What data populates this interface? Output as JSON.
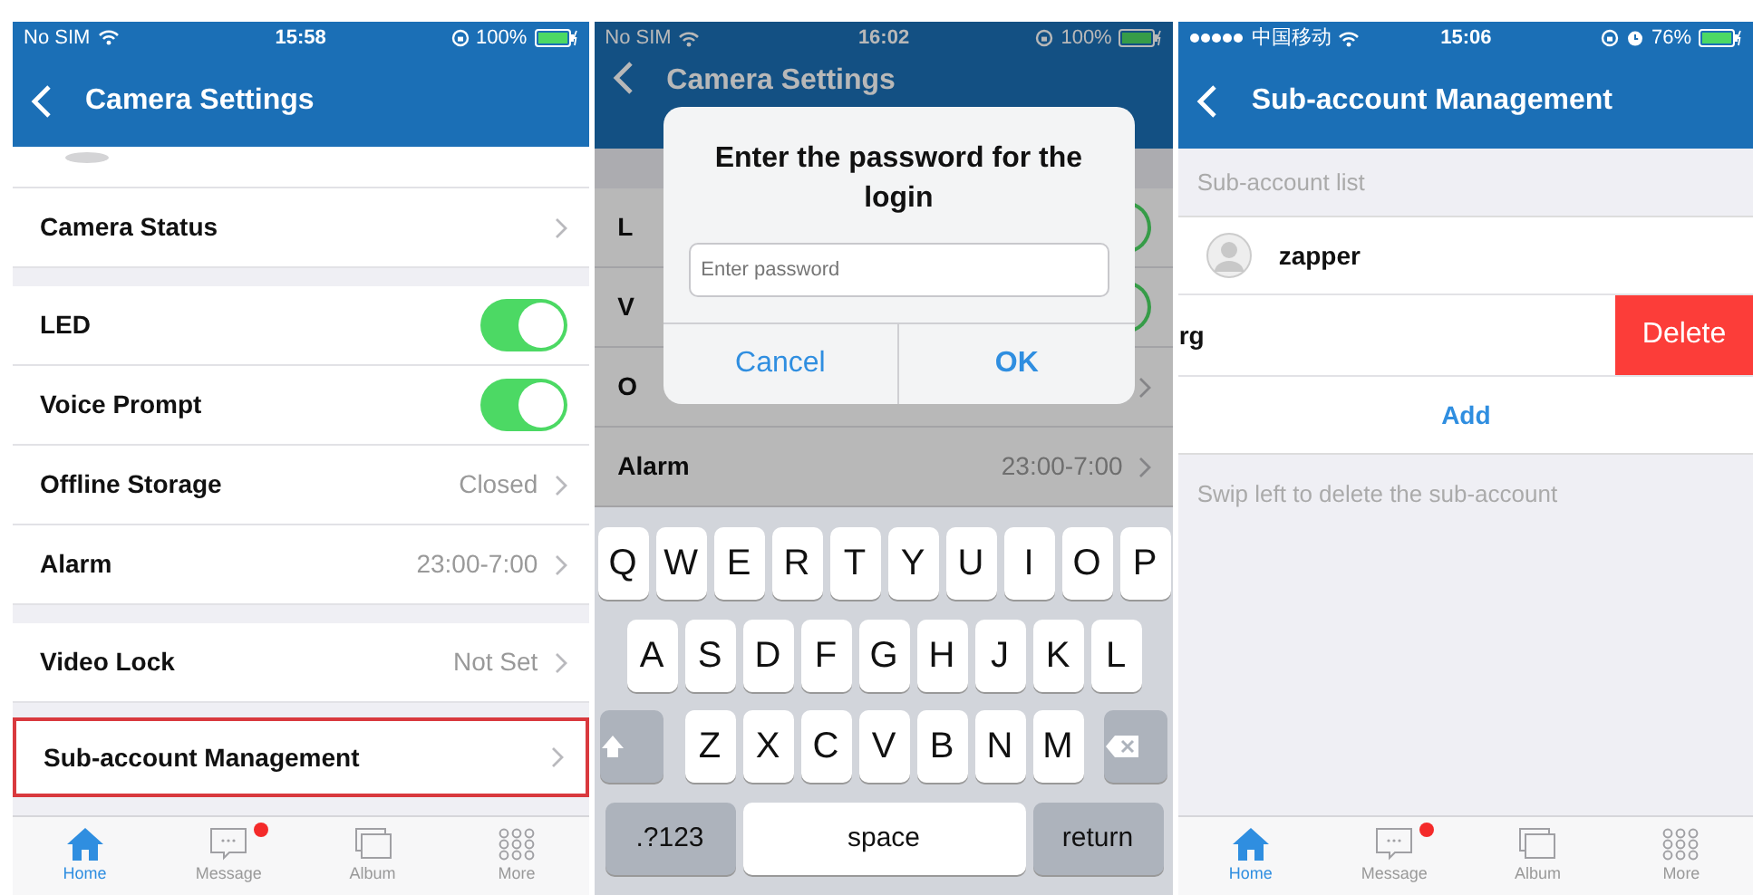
{
  "screen_settings": {
    "status_bar": {
      "carrier": "No SIM",
      "time": "15:58",
      "battery": "100%"
    },
    "nav": {
      "title": "Camera Settings"
    },
    "groups": [
      [
        {
          "kind": "link",
          "label": "Camera Status",
          "highlighted": false
        }
      ],
      [
        {
          "kind": "toggle",
          "label": "LED",
          "on": true,
          "highlighted": false
        },
        {
          "kind": "toggle",
          "label": "Voice Prompt",
          "on": true,
          "highlighted": false
        },
        {
          "kind": "link",
          "label": "Offline Storage",
          "value": "Closed",
          "highlighted": false
        },
        {
          "kind": "link",
          "label": "Alarm",
          "value": "23:00-7:00",
          "highlighted": false
        }
      ],
      [
        {
          "kind": "link",
          "label": "Video Lock",
          "value": "Not Set",
          "highlighted": false
        }
      ],
      [
        {
          "kind": "link",
          "label": "Sub-account Management",
          "highlighted": true
        }
      ]
    ],
    "tab_bar": [
      {
        "label": "Home",
        "selected": true,
        "badge": false
      },
      {
        "label": "Message",
        "selected": false,
        "badge": true
      },
      {
        "label": "Album",
        "selected": false,
        "badge": false
      },
      {
        "label": "More",
        "selected": false,
        "badge": false
      }
    ]
  },
  "screen_password": {
    "status_bar": {
      "carrier": "No SIM",
      "time": "16:02",
      "battery": "100%"
    },
    "nav": {
      "title": "Camera Settings"
    },
    "rows": [
      {
        "kind": "toggle",
        "label": "L",
        "on": true
      },
      {
        "kind": "toggle",
        "label": "V",
        "on": true
      },
      {
        "kind": "link",
        "label": "O"
      },
      {
        "kind": "link",
        "label": "Alarm",
        "value": "23:00-7:00"
      }
    ],
    "dialog": {
      "title": "Enter the password for the login",
      "placeholder": "Enter password",
      "buttons": [
        "Cancel",
        "OK"
      ]
    },
    "keyboard": {
      "rows": [
        [
          "Q",
          "W",
          "E",
          "R",
          "T",
          "Y",
          "U",
          "I",
          "O",
          "P"
        ],
        [
          "A",
          "S",
          "D",
          "F",
          "G",
          "H",
          "J",
          "K",
          "L"
        ],
        [
          "Z",
          "X",
          "C",
          "V",
          "B",
          "N",
          "M"
        ]
      ],
      "bottom": [
        ".?123",
        "space",
        "return"
      ]
    }
  },
  "screen_sub_accounts": {
    "status_bar": {
      "carrier": "中国移动",
      "time": "15:06",
      "battery": "76%"
    },
    "nav": {
      "title": "Sub-account Management"
    },
    "section_header": "Sub-account list",
    "accounts": [
      {
        "name": "zapper",
        "swiped": false
      },
      {
        "name": "rg",
        "swiped": true
      }
    ],
    "delete_label": "Delete",
    "add_label": "Add",
    "footer": "Swip left to delete the sub-account",
    "tab_bar": [
      {
        "label": "Home",
        "selected": true,
        "badge": false
      },
      {
        "label": "Message",
        "selected": false,
        "badge": true
      },
      {
        "label": "Album",
        "selected": false,
        "badge": false
      },
      {
        "label": "More",
        "selected": false,
        "badge": false
      }
    ]
  }
}
